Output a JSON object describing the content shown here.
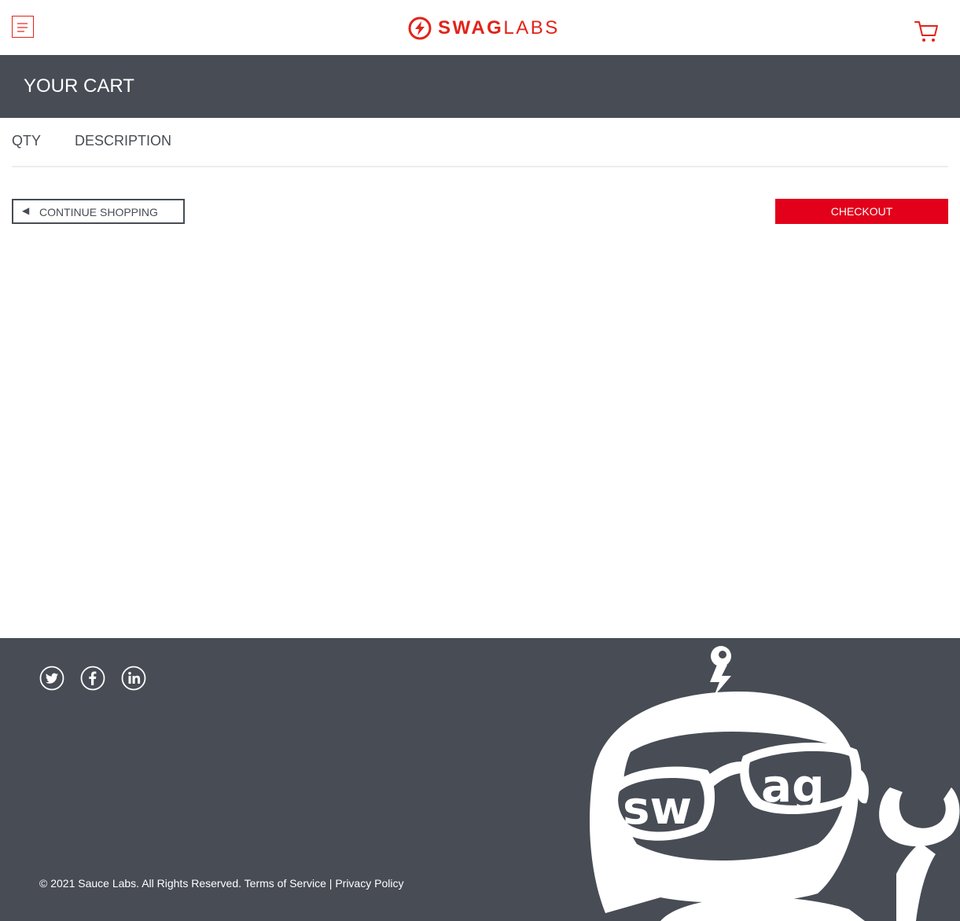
{
  "header": {
    "menu_icon": "hamburger-menu-icon",
    "logo_text_bold": "SWAG",
    "logo_text_light": "LABS",
    "cart_icon": "shopping-cart-icon"
  },
  "subheader": {
    "title": "YOUR CART"
  },
  "cart_table": {
    "qty_label": "QTY",
    "description_label": "DESCRIPTION"
  },
  "actions": {
    "continue_arrow": "◀",
    "continue_label": "CONTINUE SHOPPING",
    "checkout_label": "CHECKOUT"
  },
  "footer": {
    "social": [
      "twitter-icon",
      "facebook-icon",
      "linkedin-icon"
    ],
    "copyright": "© 2021 Sauce Labs. All Rights Reserved. Terms of Service | Privacy Policy",
    "mascot_glasses_left": "sw",
    "mascot_glasses_right": "ag"
  },
  "colors": {
    "brand_red": "#e2231a",
    "checkout_red": "#e2001a",
    "dark_gray": "#474c55",
    "divider": "#ededef"
  }
}
